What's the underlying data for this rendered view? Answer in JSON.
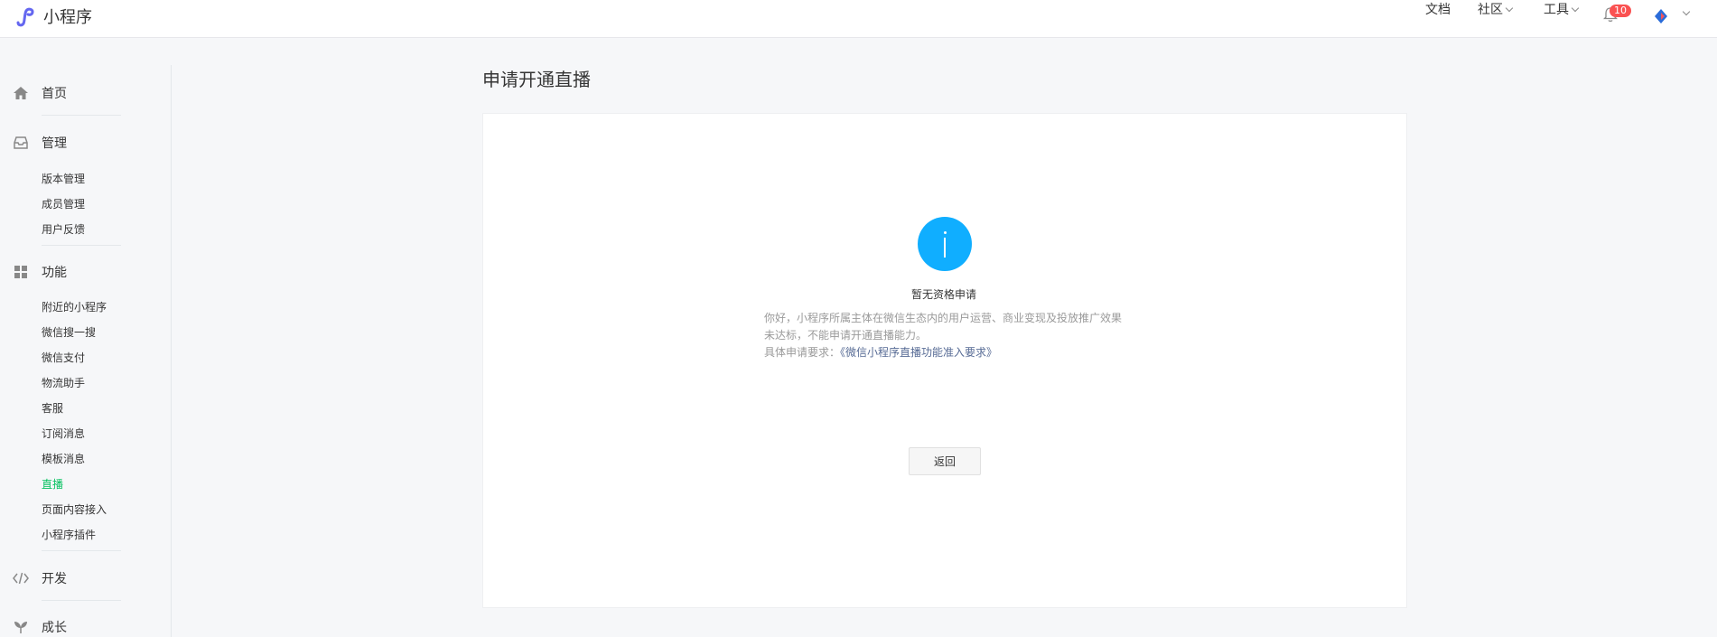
{
  "header": {
    "app_name": "小程序",
    "nav": {
      "docs": "文档",
      "community": "社区",
      "tools": "工具"
    },
    "notification_count": "10"
  },
  "sidebar": {
    "home": "首页",
    "manage": "管理",
    "manage_items": [
      "版本管理",
      "成员管理",
      "用户反馈"
    ],
    "features": "功能",
    "feature_items": [
      "附近的小程序",
      "微信搜一搜",
      "微信支付",
      "物流助手",
      "客服",
      "订阅消息",
      "模板消息",
      "直播",
      "页面内容接入",
      "小程序插件"
    ],
    "active_item": "直播",
    "develop": "开发",
    "growth": "成长"
  },
  "main": {
    "title": "申请开通直播",
    "status_title": "暂无资格申请",
    "description": "你好，小程序所属主体在微信生态内的用户运营、商业变现及投放推广效果未达标，不能申请开通直播能力。",
    "requirement_label": "具体申请要求：",
    "requirement_link": "《微信小程序直播功能准入要求》",
    "back_button": "返回"
  },
  "colors": {
    "accent": "#07c160",
    "info": "#10aeff",
    "link": "#576b95",
    "badge": "#fa5151"
  }
}
